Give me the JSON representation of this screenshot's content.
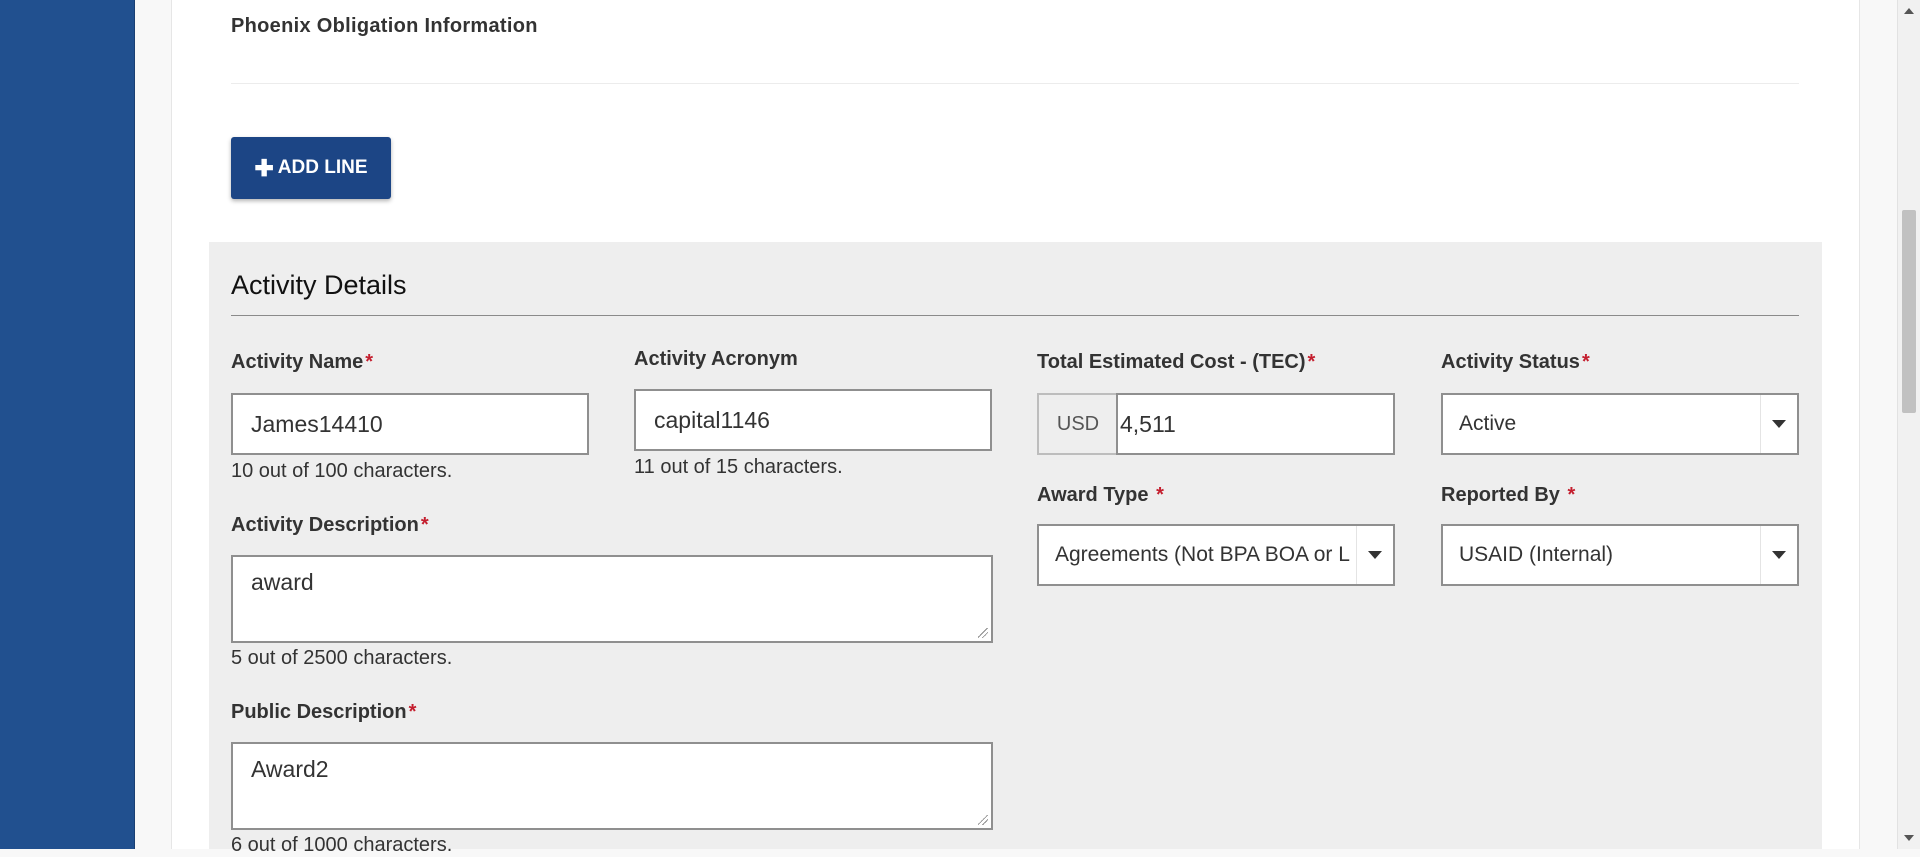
{
  "obligation_section": {
    "title": "Phoenix Obligation Information"
  },
  "add_line_button": {
    "label": "ADD LINE",
    "icon": "plus-icon"
  },
  "activity_details": {
    "title": "Activity Details",
    "required_marker": "*",
    "activity_name": {
      "label": "Activity Name",
      "value": "James14410",
      "helper": "10 out of 100 characters."
    },
    "activity_acronym": {
      "label": "Activity Acronym",
      "value": "capital1146",
      "helper": "11 out of 15 characters."
    },
    "total_estimated_cost": {
      "label": "Total Estimated Cost - (TEC)",
      "currency": "USD",
      "value": "4,511"
    },
    "activity_status": {
      "label": "Activity Status",
      "value": "Active"
    },
    "award_type": {
      "label": "Award Type",
      "value": "Agreements (Not BPA BOA or L"
    },
    "reported_by": {
      "label": "Reported By",
      "value": "USAID (Internal)"
    },
    "activity_description": {
      "label": "Activity Description",
      "value": "award",
      "helper": "5 out of 2500 characters."
    },
    "public_description": {
      "label": "Public Description",
      "value": "Award2",
      "helper": "6 out of 1000 characters."
    }
  },
  "colors": {
    "sidebar": "#21508f",
    "primary_button": "#1c4585",
    "required": "#c41e2e",
    "panel_bg": "#eeeeee"
  }
}
